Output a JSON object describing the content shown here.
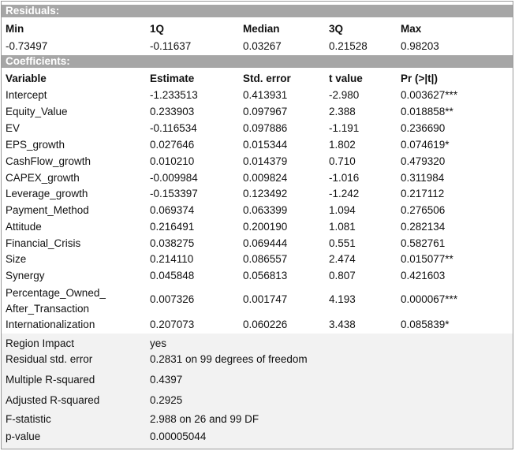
{
  "residuals": {
    "title": "Residuals:",
    "headers": [
      "Min",
      "1Q",
      "Median",
      "3Q",
      "Max"
    ],
    "values": [
      "-0.73497",
      "-0.11637",
      "0.03267",
      "0.21528",
      "0.98203"
    ]
  },
  "coefficients": {
    "title": "Coefficients:",
    "headers": [
      "Variable",
      "Estimate",
      "Std. error",
      "t value",
      "Pr (>|t|)"
    ],
    "rows": [
      [
        "Intercept",
        "-1.233513",
        "0.413931",
        "-2.980",
        "0.003627***"
      ],
      [
        "Equity_Value",
        "0.233903",
        "0.097967",
        "2.388",
        "0.018858**"
      ],
      [
        "EV",
        "-0.116534",
        "0.097886",
        "-1.191",
        "0.236690"
      ],
      [
        "EPS_growth",
        "0.027646",
        "0.015344",
        "1.802",
        "0.074619*"
      ],
      [
        "CashFlow_growth",
        "0.010210",
        "0.014379",
        "0.710",
        "0.479320"
      ],
      [
        "CAPEX_growth",
        "-0.009984",
        "0.009824",
        "-1.016",
        "0.311984"
      ],
      [
        "Leverage_growth",
        "-0.153397",
        "0.123492",
        "-1.242",
        "0.217112"
      ],
      [
        "Payment_Method",
        "0.069374",
        "0.063399",
        "1.094",
        "0.276506"
      ],
      [
        "Attitude",
        "0.216491",
        "0.200190",
        "1.081",
        "0.282134"
      ],
      [
        "Financial_Crisis",
        "0.038275",
        "0.069444",
        "0.551",
        "0.582761"
      ],
      [
        "Size",
        "0.214110",
        "0.086557",
        "2.474",
        "0.015077**"
      ],
      [
        "Synergy",
        "0.045848",
        "0.056813",
        "0.807",
        "0.421603"
      ],
      [
        "Percentage_Owned_ After_Transaction",
        "0.007326",
        "0.001747",
        "4.193",
        "0.000067***"
      ],
      [
        "Internationalization",
        "0.207073",
        "0.060226",
        "3.438",
        "0.085839*"
      ]
    ]
  },
  "summary": [
    [
      "Region Impact",
      "yes"
    ],
    [
      "Residual std. error",
      "0.2831 on 99 degrees of freedom"
    ],
    [
      "Multiple R-squared",
      "0.4397"
    ],
    [
      "Adjusted R-squared",
      "0.2925"
    ],
    [
      "F-statistic",
      "2.988 on 26 and 99 DF"
    ],
    [
      "p-value",
      "0.00005044"
    ]
  ]
}
